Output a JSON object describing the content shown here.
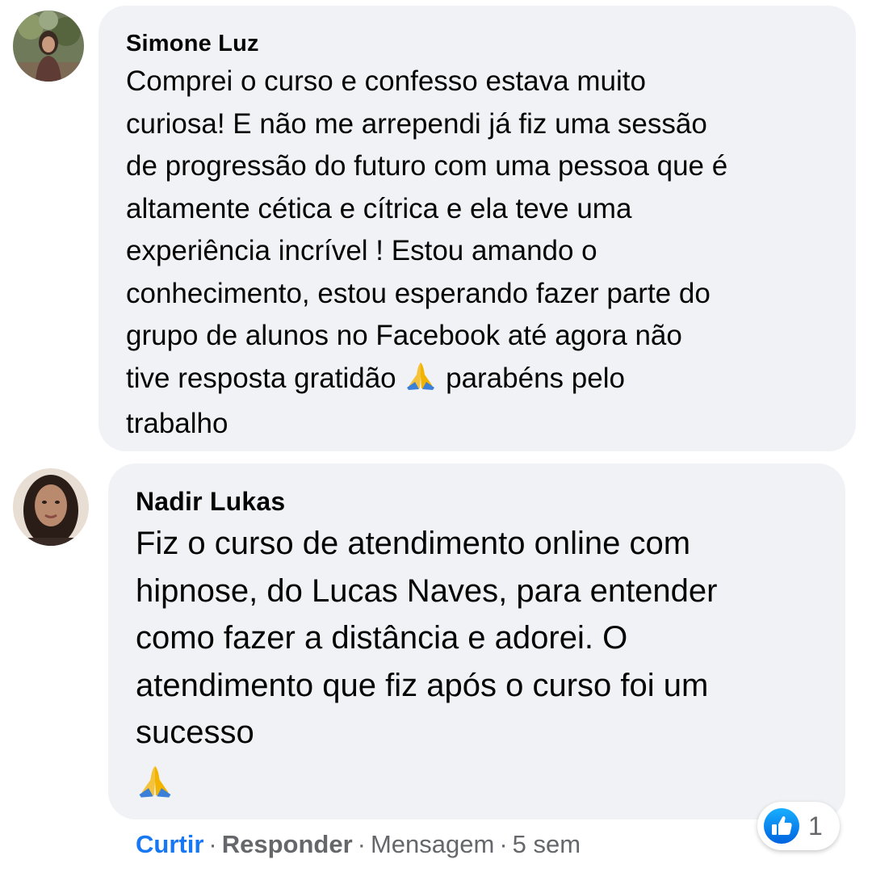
{
  "comments": [
    {
      "author": "Simone Luz",
      "text_main": "Comprei o curso e confesso estava muito\ncuriosa! E não me arrependi já fiz uma sessão\nde progressão do futuro com uma pessoa que é\naltamente cética e cítrica e ela teve uma\nexperiência incrível ! Estou amando o\nconhecimento, estou esperando fazer parte do\ngrupo de alunos no Facebook até agora não\ntive resposta gratidão",
      "text_after_emoji": " parabéns pelo\ntrabalho",
      "emoji_icon": "praying-hands-icon"
    },
    {
      "author": "Nadir Lukas",
      "text": "Fiz o curso de atendimento online com\nhipnose, do Lucas Naves, para entender\ncomo fazer a distância e adorei. O\natendimento que fiz após o curso foi um\nsucesso",
      "emoji_icon": "praying-hands-icon",
      "reactions": {
        "icon": "like-icon",
        "count": "1"
      },
      "actions": {
        "like": "Curtir",
        "separator": "·",
        "reply": "Responder",
        "message": "Mensagem",
        "time": "5 sem"
      }
    }
  ],
  "colors": {
    "bubble": "#f0f2f5",
    "text": "#050505",
    "meta": "#65676b",
    "accent": "#1877f2"
  }
}
